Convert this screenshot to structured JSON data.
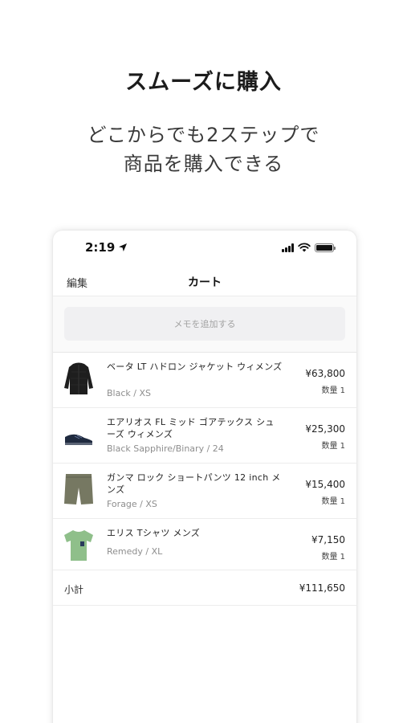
{
  "promo": {
    "title": "スムーズに購入",
    "subtitle_line1": "どこからでも2ステップで",
    "subtitle_line2": "商品を購入できる"
  },
  "status_bar": {
    "time": "2:19",
    "icons": [
      "location-arrow-icon",
      "signal-icon",
      "wifi-icon",
      "battery-icon"
    ]
  },
  "nav": {
    "edit_label": "編集",
    "title": "カート"
  },
  "memo": {
    "button_label": "メモを追加する"
  },
  "cart": {
    "items": [
      {
        "name": "ベータ LT ハドロン ジャケット ウィメンズ",
        "variant": "Black / XS",
        "price": "¥63,800",
        "quantity": "数量 1",
        "thumb_icon": "jacket-icon",
        "thumb_color": "#1e1e1e"
      },
      {
        "name": "エアリオス FL ミッド ゴアテックス シューズ ウィメンズ",
        "variant": "Black Sapphire/Binary / 24",
        "price": "¥25,300",
        "quantity": "数量 1",
        "thumb_icon": "shoe-icon",
        "thumb_color": "#1f2a3f"
      },
      {
        "name": "ガンマ ロック ショートパンツ 12 inch メンズ",
        "variant": "Forage / XS",
        "price": "¥15,400",
        "quantity": "数量 1",
        "thumb_icon": "shorts-icon",
        "thumb_color": "#767862"
      },
      {
        "name": "エリス Tシャツ メンズ",
        "variant": "Remedy / XL",
        "price": "¥7,150",
        "quantity": "数量 1",
        "thumb_icon": "tshirt-icon",
        "thumb_color": "#8fbf8a"
      }
    ],
    "subtotal_label": "小計",
    "subtotal_value": "¥111,650"
  }
}
